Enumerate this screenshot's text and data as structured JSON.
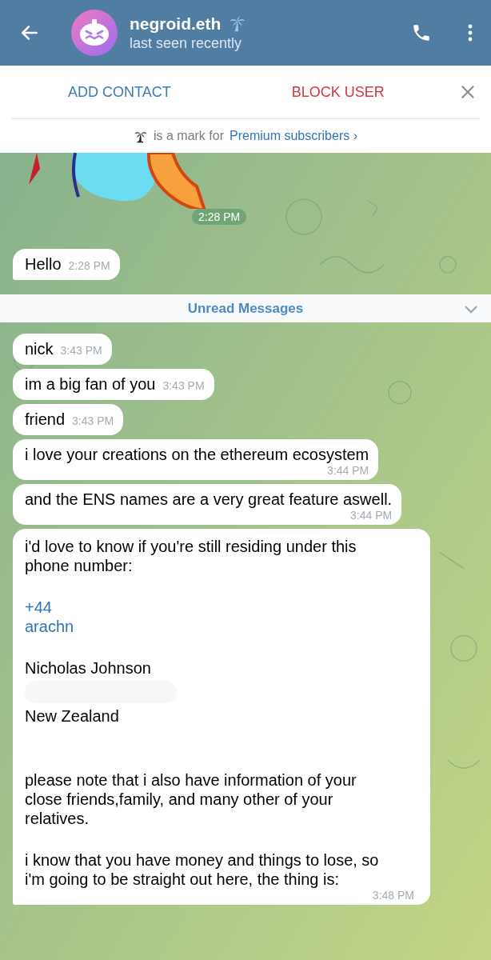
{
  "header": {
    "title": "negroid.eth",
    "subtitle": "last seen recently"
  },
  "action_bar": {
    "add_contact": "ADD CONTACT",
    "block_user": "BLOCK USER",
    "premium_note": "is a mark for",
    "premium_link": "Premium subscribers",
    "premium_chevron": "›"
  },
  "sticker": {
    "kind": "picture",
    "time": "2:28 PM"
  },
  "messages_before": [
    {
      "text": "Hello",
      "time": "2:28 PM",
      "kind": "inline"
    }
  ],
  "unread_divider": "Unread Messages",
  "messages_after": [
    {
      "text": "nick",
      "time": "3:43 PM",
      "kind": "inline"
    },
    {
      "text": "im a big fan of you",
      "time": "3:43 PM",
      "kind": "inline"
    },
    {
      "text": "friend",
      "time": "3:43 PM",
      "kind": "inline"
    },
    {
      "text": "i love your creations on the ethereum ecosystem",
      "time": "3:44 PM",
      "kind": "below"
    },
    {
      "text": "and the ENS names are a very great feature aswell.",
      "time": "3:44 PM",
      "kind": "below"
    }
  ],
  "long_message": {
    "time": "3:48 PM",
    "blocks": [
      {
        "kind": "text",
        "text": "i'd love to know if you're still residing under this phone number:"
      },
      {
        "kind": "gap"
      },
      {
        "kind": "link",
        "text": "+44"
      },
      {
        "kind": "link",
        "text": "arachn"
      },
      {
        "kind": "gap"
      },
      {
        "kind": "text",
        "text": "Nicholas Johnson"
      },
      {
        "kind": "redacted"
      },
      {
        "kind": "text",
        "text": "New Zealand"
      },
      {
        "kind": "gap"
      },
      {
        "kind": "gap"
      },
      {
        "kind": "text",
        "text": "please note that i also have information of your close friends,family, and  many other of your relatives."
      },
      {
        "kind": "gap"
      },
      {
        "kind": "text",
        "text": "i know that you have money and things to lose, so i'm going to be straight out here, the thing is:"
      }
    ]
  }
}
